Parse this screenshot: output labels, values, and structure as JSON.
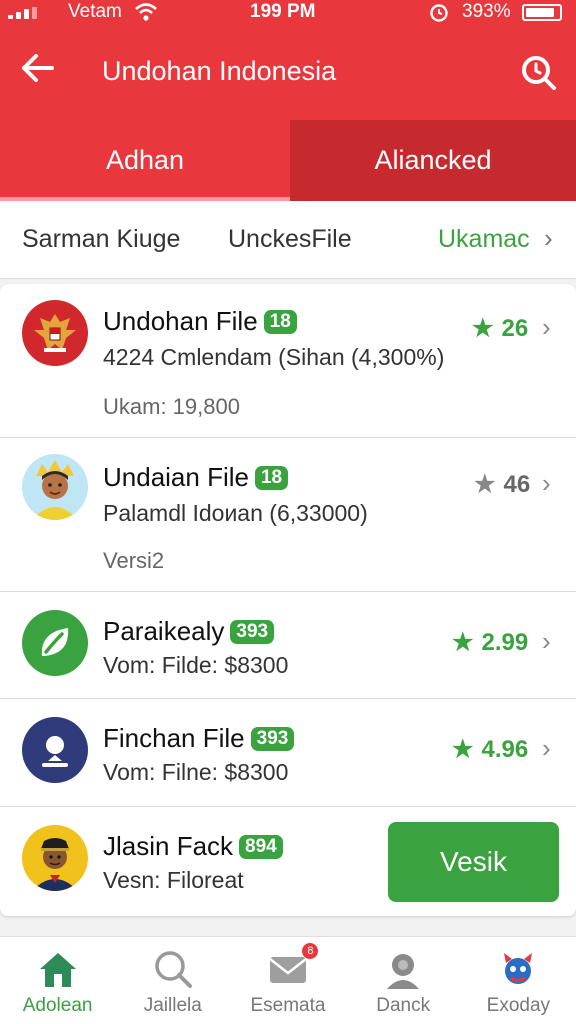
{
  "status_bar": {
    "carrier": "Vetam",
    "time": "199 PM",
    "battery_pct": "393%"
  },
  "header": {
    "title": "Undohan Indonesia"
  },
  "tabs": [
    {
      "label": "Adhan",
      "active": true
    },
    {
      "label": "Aliancked"
    }
  ],
  "filters": {
    "left": "Sarman Kiuge",
    "middle": "UnckesFile",
    "right": "Ukamac"
  },
  "items": [
    {
      "name": "Undohan File",
      "badge": "18",
      "line2": "4224 Cmlendam (Sihan (4,300%)",
      "line3": "Ukam: 19,800",
      "rating": "26",
      "rating_style": "green"
    },
    {
      "name": "Undaian File",
      "badge": "18",
      "line2": "Palamdl Idoиan (6,33000)",
      "line3": "Versi2",
      "rating": "46",
      "rating_style": "grey"
    },
    {
      "name": "Paraikealy",
      "badge": "393",
      "line2": "Vom: Filde:  $8300",
      "rating": "2.99",
      "rating_style": "green"
    },
    {
      "name": "Finchan File",
      "badge": "393",
      "line2": "Vom: Filne:  $8300",
      "rating": "4.96",
      "rating_style": "green"
    },
    {
      "name": "Jlasin Fack",
      "badge": "894",
      "line2": "Vesn: Filoreat",
      "button_label": "Vesik"
    }
  ],
  "bottom_nav": [
    {
      "label": "Adolean",
      "icon": "home-icon",
      "active": true
    },
    {
      "label": "Jaillela",
      "icon": "search-icon"
    },
    {
      "label": "Esemata",
      "icon": "mail-icon",
      "notification": "8"
    },
    {
      "label": "Danck",
      "icon": "user-icon"
    },
    {
      "label": "Exoday",
      "icon": "mascot-icon"
    }
  ],
  "colors": {
    "primary_red": "#e8383d",
    "dark_red": "#c62a2f",
    "accent_green": "#3aa23f"
  }
}
